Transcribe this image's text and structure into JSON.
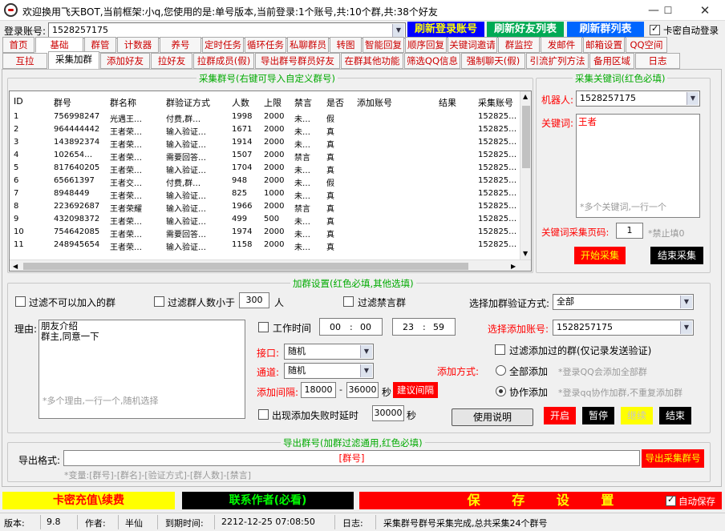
{
  "window": {
    "title": "欢迎换用飞天BOT,当前框架:小q,您使用的是:单号版本,当前登录:1个账号,共:10个群,共:38个好友"
  },
  "login": {
    "label": "登录账号:",
    "value": "1528257175",
    "refresh_login": "刷新登录账号",
    "refresh_friends": "刷新好友列表",
    "refresh_groups": "刷新群列表",
    "auto_login": "卡密自动登录"
  },
  "tabs_row1": [
    "首页",
    "基础",
    "群管",
    "计数器",
    "养号",
    "定时任务",
    "循环任务",
    "私聊群员",
    "转图",
    "智能回复",
    "顺序回复",
    "关键词邀请",
    "群监控",
    "发邮件",
    "邮箱设置",
    "QQ空间"
  ],
  "tabs_row2": [
    "互拉",
    "采集加群",
    "添加好友",
    "拉好友",
    "拉群成员(假)",
    "导出群号群员好友",
    "在群其他功能",
    "筛选QQ信息",
    "强制聊天(假)",
    "引流扩列方法",
    "备用区域",
    "日志"
  ],
  "collect": {
    "title": "采集群号(右键可导入自定义群号)",
    "headers": [
      "ID",
      "群号",
      "群名称",
      "群验证方式",
      "人数",
      "上限",
      "禁言",
      "是否",
      "添加账号",
      "结果",
      "采集账号"
    ],
    "rows": [
      [
        "1",
        "756998247",
        "光遇王…",
        "付费,群…",
        "1998",
        "2000",
        "未…",
        "假",
        "",
        "",
        "152825…"
      ],
      [
        "2",
        "964444442",
        "王者荣…",
        "输入验证…",
        "1671",
        "2000",
        "未…",
        "真",
        "",
        "",
        "152825…"
      ],
      [
        "3",
        "143892374",
        "王者荣…",
        "输入验证…",
        "1914",
        "2000",
        "未…",
        "真",
        "",
        "",
        "152825…"
      ],
      [
        "4",
        "102654…",
        "王者荣…",
        "需要回答…",
        "1507",
        "2000",
        "禁言",
        "真",
        "",
        "",
        "152825…"
      ],
      [
        "5",
        "817640205",
        "王者荣…",
        "输入验证…",
        "1704",
        "2000",
        "未…",
        "真",
        "",
        "",
        "152825…"
      ],
      [
        "6",
        "65661397",
        "王者交…",
        "付费,群…",
        "948",
        "2000",
        "未…",
        "假",
        "",
        "",
        "152825…"
      ],
      [
        "7",
        "8948449",
        "王者荣…",
        "输入验证…",
        "825",
        "1000",
        "未…",
        "真",
        "",
        "",
        "152825…"
      ],
      [
        "8",
        "223692687",
        "王者荣耀",
        "输入验证…",
        "1966",
        "2000",
        "禁言",
        "真",
        "",
        "",
        "152825…"
      ],
      [
        "9",
        "432098372",
        "王者荣…",
        "输入验证…",
        "499",
        "500",
        "未…",
        "真",
        "",
        "",
        "152825…"
      ],
      [
        "10",
        "754642085",
        "王者荣…",
        "需要回答…",
        "1974",
        "2000",
        "未…",
        "真",
        "",
        "",
        "152825…"
      ],
      [
        "11",
        "248945654",
        "王者荣…",
        "输入验证…",
        "1158",
        "2000",
        "未…",
        "真",
        "",
        "",
        "152825…"
      ]
    ]
  },
  "keywords": {
    "title": "采集关键词(红色必填)",
    "robot_label": "机器人:",
    "robot_value": "1528257175",
    "kw_label": "关键词:",
    "kw_value": "王者",
    "kw_placeholder": "*多个关键词,一行一个",
    "page_label": "关键词采集页码:",
    "page_value": "1",
    "page_hint": "*禁止填0",
    "start": "开始采集",
    "end": "结束采集"
  },
  "join": {
    "title": "加群设置(红色必填,其他选填)",
    "filter_cant": "过滤不可以加入的群",
    "filter_less": "过滤群人数小于",
    "less_value": "300",
    "less_unit": "人",
    "filter_mute": "过滤禁言群",
    "verify_label": "选择加群验证方式:",
    "verify_value": "全部",
    "reason_label": "理由:",
    "reason_value": "朋友介绍\n群主,同意一下",
    "reason_placeholder": "*多个理由,一行一个,随机选择",
    "worktime": "工作时间",
    "t1h": "00",
    "t1m": "00",
    "t2h": "23",
    "t2m": "59",
    "colon": ":",
    "port_label": "接口:",
    "port_value": "随机",
    "channel_label": "通道:",
    "channel_value": "随机",
    "interval_label": "添加间隔:",
    "int_from": "18000",
    "dash": "-",
    "int_to": "36000",
    "sec": "秒",
    "suggest": "建议间隔",
    "fail_label": "出现添加失败时延时",
    "fail_value": "30000",
    "fail_unit": "秒",
    "manual": "使用说明",
    "acct_label": "选择添加账号:",
    "acct_value": "1528257175",
    "filter_added": "过滤添加过的群(仅记录发送验证)",
    "mode_label": "添加方式:",
    "mode_all": "全部添加",
    "mode_all_hint": "*登录QQ会添加全部群",
    "mode_coop": "协作添加",
    "mode_coop_hint": "*登录qq协作加群,不重复添加群",
    "btn_start": "开启",
    "btn_pause": "暂停",
    "btn_resume": "继续",
    "btn_end": "结束"
  },
  "export": {
    "title": "导出群号(加群过滤通用,红色必填)",
    "fmt_label": "导出格式:",
    "fmt_value": "[群号]",
    "fmt_hint": "*变量:[群号]-[群名]-[验证方式]-[群人数]-[禁言]",
    "btn": "导出采集群号"
  },
  "bottom": {
    "recharge": "卡密充值\\续费",
    "contact": "联系作者(必看)",
    "save": "保 存 设 置",
    "auto_save": "自动保存"
  },
  "status": {
    "version_label": "版本:",
    "version": "9.8",
    "author_label": "作者:",
    "author": "半仙",
    "expire_label": "到期时间:",
    "expire": "2212-12-25 07:08:50",
    "log_label": "日志:",
    "log": "采集群号群号采集完成,总共采集24个群号"
  }
}
